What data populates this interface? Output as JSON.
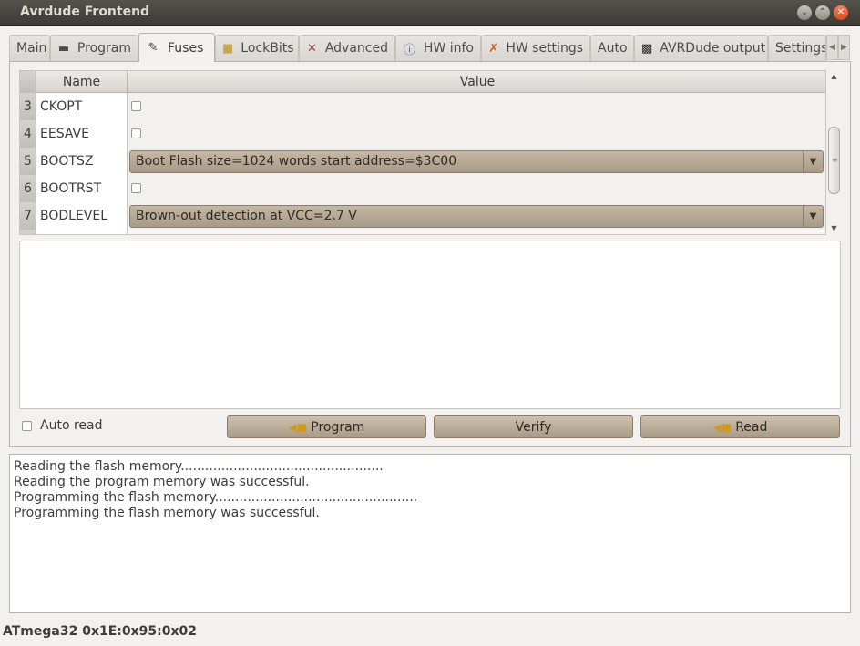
{
  "window": {
    "title": "Avrdude Frontend"
  },
  "tabs": [
    {
      "label": "Main",
      "icon": ""
    },
    {
      "label": "Program",
      "icon": "chip-icon"
    },
    {
      "label": "Fuses",
      "icon": "wrench-icon"
    },
    {
      "label": "LockBits",
      "icon": "lock-icon"
    },
    {
      "label": "Advanced",
      "icon": "advanced-icon"
    },
    {
      "label": "HW info",
      "icon": "info-icon"
    },
    {
      "label": "HW settings",
      "icon": "tools-icon"
    },
    {
      "label": "Auto",
      "icon": ""
    },
    {
      "label": "AVRDude output",
      "icon": "terminal-icon"
    },
    {
      "label": "Settings",
      "icon": ""
    }
  ],
  "active_tab": "Fuses",
  "grid": {
    "headers": {
      "name": "Name",
      "value": "Value"
    },
    "rows": [
      {
        "num": "3",
        "name": "CKOPT",
        "type": "checkbox",
        "checked": false
      },
      {
        "num": "4",
        "name": "EESAVE",
        "type": "checkbox",
        "checked": false
      },
      {
        "num": "5",
        "name": "BOOTSZ",
        "type": "combo",
        "value": "Boot Flash size=1024 words start address=$3C00"
      },
      {
        "num": "6",
        "name": "BOOTRST",
        "type": "checkbox",
        "checked": false
      },
      {
        "num": "7",
        "name": "BODLEVEL",
        "type": "combo",
        "value": "Brown-out detection at VCC=2.7 V"
      }
    ]
  },
  "controls": {
    "auto_read_label": "Auto read",
    "auto_read_checked": false,
    "program_label": "Program",
    "verify_label": "Verify",
    "read_label": "Read"
  },
  "log": [
    "Reading the flash memory..................................................",
    "Reading the program memory was successful.",
    "Programming the flash memory..................................................",
    "Programming the flash memory was successful."
  ],
  "status": "ATmega32 0x1E:0x95:0x02",
  "colors": {
    "titlebar": "#3c3b37",
    "button": "#b8ab96",
    "close": "#e45e2d"
  }
}
